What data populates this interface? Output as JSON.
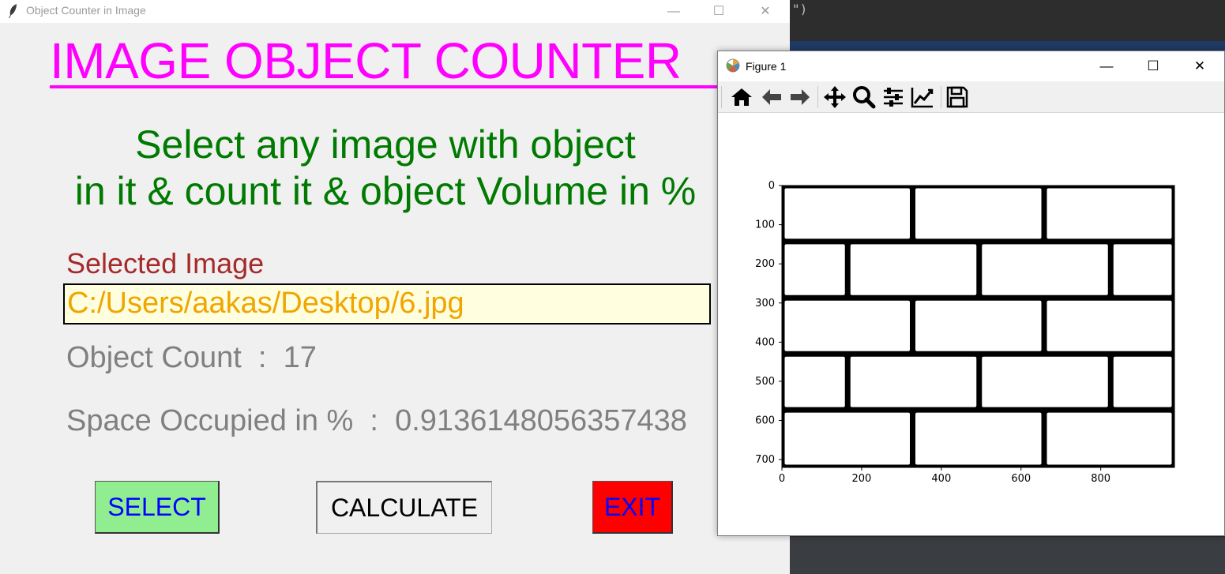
{
  "background_editor": {
    "text": "\")"
  },
  "main_window": {
    "title": "Object Counter in Image",
    "titlebar_buttons": {
      "minimize": "—",
      "maximize": "☐",
      "close": "✕"
    },
    "heading": "IMAGE OBJECT COUNTER",
    "subtitle_line1": "Select any image with object",
    "subtitle_line2": "in it & count it & object Volume in %",
    "selected_label": "Selected Image",
    "selected_path": "C:/Users/aakas/Desktop/6.jpg",
    "count_label": "Object Count  :  ",
    "count_value": "17",
    "space_label": "Space Occupied in %  :  ",
    "space_value": "0.9136148056357438",
    "buttons": {
      "select": "SELECT",
      "calculate": "CALCULATE",
      "exit": "EXIT"
    },
    "colors": {
      "heading": "#ff00ff",
      "subtitle": "#007a00",
      "select_bg": "#90ee90",
      "exit_bg": "#ff0000",
      "path_bg": "#ffffe0",
      "path_fg": "#f0a500"
    }
  },
  "figure_window": {
    "title": "Figure 1",
    "titlebar_buttons": {
      "minimize": "—",
      "maximize": "☐",
      "close": "✕"
    },
    "toolbar_icons": [
      "home-icon",
      "back-arrow-icon",
      "forward-arrow-icon",
      "pan-icon",
      "zoom-icon",
      "subplots-config-icon",
      "edit-axis-icon",
      "save-icon"
    ]
  },
  "chart_data": {
    "type": "image",
    "description_kind": "binary brick wall image shown with imshow",
    "xlim": [
      0,
      985
    ],
    "ylim": [
      720,
      0
    ],
    "xticks": [
      0,
      200,
      400,
      600,
      800
    ],
    "yticks": [
      0,
      100,
      200,
      300,
      400,
      500,
      600,
      700
    ],
    "rows": [
      {
        "y0": 0,
        "y1": 143,
        "cuts": [
          0,
          328,
          658,
          985
        ]
      },
      {
        "y0": 143,
        "y1": 287,
        "cuts": [
          0,
          165,
          495,
          825,
          985
        ]
      },
      {
        "y0": 287,
        "y1": 430,
        "cuts": [
          0,
          328,
          658,
          985
        ]
      },
      {
        "y0": 430,
        "y1": 573,
        "cuts": [
          0,
          165,
          495,
          825,
          985
        ]
      },
      {
        "y0": 573,
        "y1": 720,
        "cuts": [
          0,
          328,
          658,
          985
        ]
      }
    ]
  }
}
